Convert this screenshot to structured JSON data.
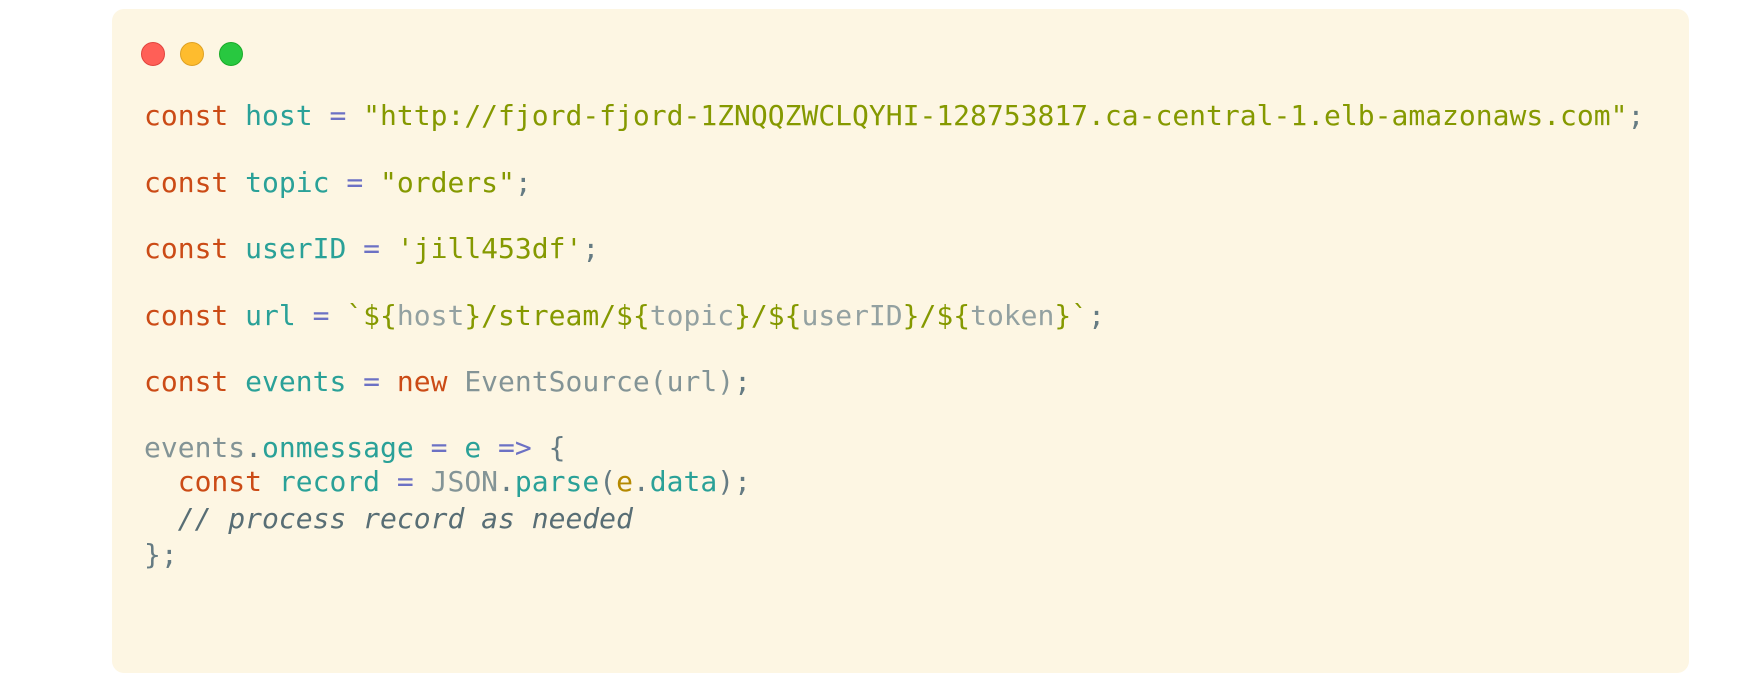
{
  "window": {
    "controls": [
      "close",
      "minimize",
      "maximize"
    ],
    "colors": {
      "close": "#ff5f57",
      "minimize": "#febc2e",
      "maximize": "#28c840",
      "background": "#fdf6e3"
    }
  },
  "code": {
    "line1": {
      "kw": "const",
      "name": "host",
      "eq": "=",
      "value": "\"http://fjord-fjord-1ZNQQZWCLQYHI-128753817.ca-central-1.elb-amazonaws.com\"",
      "end": ";"
    },
    "line2": {
      "kw": "const",
      "name": "topic",
      "eq": "=",
      "value": "\"orders\"",
      "end": ";"
    },
    "line3": {
      "kw": "const",
      "name": "userID",
      "eq": "=",
      "value": "'jill453df'",
      "end": ";"
    },
    "line4": {
      "kw": "const",
      "name": "url",
      "eq": "=",
      "t1": "`${",
      "v1": "host",
      "t2": "}/stream/${",
      "v2": "topic",
      "t3": "}/${",
      "v3": "userID",
      "t4": "}/${",
      "v4": "token",
      "t5": "}`",
      "end": ";"
    },
    "line5": {
      "kw": "const",
      "name": "events",
      "eq": "=",
      "new": "new",
      "cls": "EventSource",
      "args": "(url)",
      "end": ";"
    },
    "line6": {
      "obj": "events",
      "dot": ".",
      "prop": "onmessage",
      "eq": "=",
      "param": "e",
      "arrow": "=>",
      "brace": "{"
    },
    "line7": {
      "kw": "const",
      "name": "record",
      "eq": "=",
      "json": "JSON",
      "dot": ".",
      "method": "parse",
      "open": "(",
      "arg": "e",
      "dot2": ".",
      "argprop": "data",
      "close": ");"
    },
    "line8": {
      "comment": "// process record as needed"
    },
    "line9": {
      "close": "};"
    }
  }
}
